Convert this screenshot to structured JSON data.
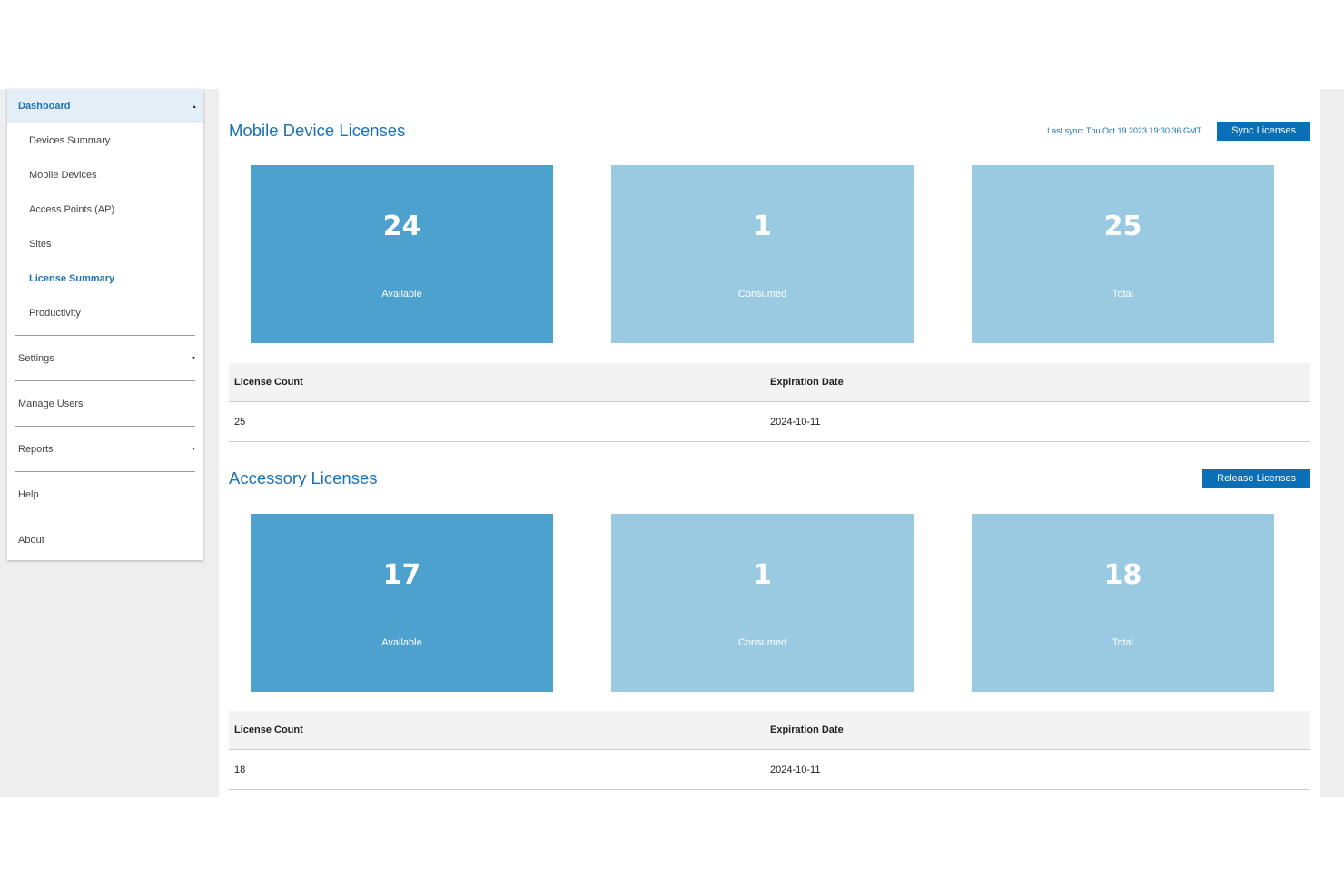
{
  "sidebar": {
    "dashboard": {
      "label": "Dashboard",
      "caret": "caret-up-icon"
    },
    "sub_items": [
      {
        "label": "Devices Summary",
        "active": false
      },
      {
        "label": "Mobile Devices",
        "active": false
      },
      {
        "label": "Access Points (AP)",
        "active": false
      },
      {
        "label": "Sites",
        "active": false
      },
      {
        "label": "License Summary",
        "active": true
      },
      {
        "label": "Productivity",
        "active": false
      }
    ],
    "items": [
      {
        "label": "Settings",
        "caret": "caret-down-icon"
      },
      {
        "label": "Manage Users"
      },
      {
        "label": "Reports",
        "caret": "caret-down-icon"
      },
      {
        "label": "Help"
      },
      {
        "label": "About"
      }
    ]
  },
  "mobile": {
    "title": "Mobile Device Licenses",
    "sync_text": "Last sync: Thu Oct 19 2023 19:30:36 GMT",
    "sync_button": "Sync Licenses",
    "tiles": [
      {
        "value": "24",
        "caption": "Available"
      },
      {
        "value": "1",
        "caption": "Consumed"
      },
      {
        "value": "25",
        "caption": "Total"
      }
    ],
    "table": {
      "headers": [
        "License Count",
        "Expiration Date"
      ],
      "rows": [
        [
          "25",
          "2024-10-11"
        ]
      ]
    }
  },
  "accessory": {
    "title": "Accessory Licenses",
    "release_button": "Release Licenses",
    "tiles": [
      {
        "value": "17",
        "caption": "Available"
      },
      {
        "value": "1",
        "caption": "Consumed"
      },
      {
        "value": "18",
        "caption": "Total"
      }
    ],
    "table": {
      "headers": [
        "License Count",
        "Expiration Date"
      ],
      "rows": [
        [
          "18",
          "2024-10-11"
        ]
      ]
    }
  },
  "colors": {
    "accent": "#1a73b5",
    "button": "#0a6fb7",
    "tile_available": "#4da1ce",
    "tile_other": "#9acae2"
  }
}
